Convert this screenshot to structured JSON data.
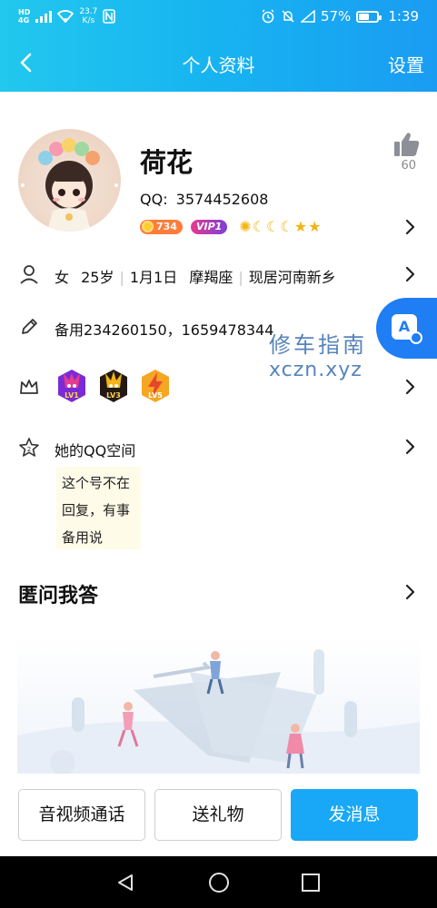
{
  "status_bar": {
    "sig1": "HD",
    "sig1_sub": "4G",
    "net_speed_value": "23.7",
    "net_speed_unit": "K/s",
    "battery_percent": "57%",
    "battery_level": 0.57,
    "time": "1:39"
  },
  "nav": {
    "title": "个人资料",
    "settings": "设置"
  },
  "profile": {
    "name": "荷花",
    "qq_label": "QQ:",
    "qq_number": "3574452608",
    "coin_badge": "734",
    "vip_badge": "VIP1",
    "likes": "60"
  },
  "info": {
    "gender": "女",
    "age": "25岁",
    "birthday": "1月1日",
    "zodiac": "摩羯座",
    "location": "现居河南新乡",
    "backup_note": "备用234260150，1659478344"
  },
  "game_levels": [
    "LV1",
    "LV3",
    "LV5"
  ],
  "qzone": {
    "title": "她的QQ空间",
    "note_lines": [
      "这个号不在",
      "回复，有事",
      "备用说"
    ]
  },
  "qa": {
    "title": "匿问我答"
  },
  "watermark": {
    "cn": "修车指南",
    "en": "xczn.xyz"
  },
  "translate_button": {
    "label": "A"
  },
  "actions": {
    "call": "音视频通话",
    "gift": "送礼物",
    "message": "发消息"
  },
  "colors": {
    "header_gradient": [
      "#22c8ee",
      "#1a9cf2"
    ],
    "primary_button": "#18a8f7",
    "translate_button": "#1f7ef4"
  }
}
